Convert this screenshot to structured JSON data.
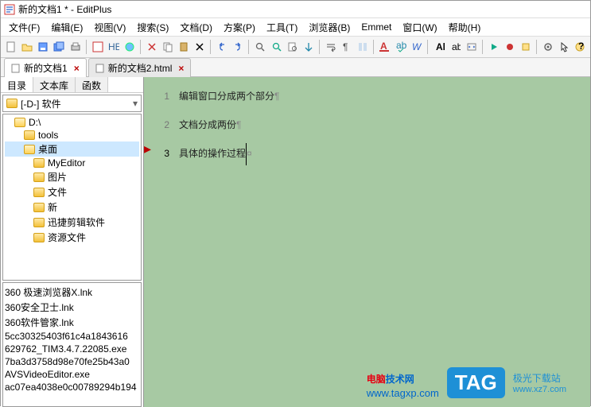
{
  "title": "新的文档1 * - EditPlus",
  "menu": [
    "文件(F)",
    "编辑(E)",
    "视图(V)",
    "搜索(S)",
    "文档(D)",
    "方案(P)",
    "工具(T)",
    "浏览器(B)",
    "Emmet",
    "窗口(W)",
    "帮助(H)"
  ],
  "tabs": [
    {
      "label": "新的文档1",
      "active": true
    },
    {
      "label": "新的文档2.html",
      "active": false
    }
  ],
  "side": {
    "tabs": [
      "目录",
      "文本库",
      "函数"
    ],
    "drive": "[-D-] 软件",
    "tree": [
      {
        "label": "D:\\",
        "cls": "indent1",
        "open": true
      },
      {
        "label": "tools",
        "cls": "indent2",
        "open": false
      },
      {
        "label": "桌面",
        "cls": "indent2 sel",
        "open": true
      },
      {
        "label": "MyEditor",
        "cls": "indent3",
        "open": false
      },
      {
        "label": "图片",
        "cls": "indent3",
        "open": false
      },
      {
        "label": "文件",
        "cls": "indent3",
        "open": false
      },
      {
        "label": "新",
        "cls": "indent3",
        "open": false
      },
      {
        "label": "迅捷剪辑软件",
        "cls": "indent3",
        "open": false
      },
      {
        "label": "资源文件",
        "cls": "indent3",
        "open": false
      }
    ],
    "files": [
      "360 极速浏览器X.lnk",
      "360安全卫士.lnk",
      "360软件管家.lnk",
      "5cc30325403f61c4a1843616",
      "629762_TIM3.4.7.22085.exe",
      "7ba3d3758d98e70fe25b43a0",
      "AVSVideoEditor.exe",
      "ac07ea4038e0c00789294b194"
    ]
  },
  "editor": {
    "lines": [
      {
        "n": "1",
        "text": "编辑窗口分成两个部分",
        "mark": "¶"
      },
      {
        "n": "2",
        "text": "文档分成两份",
        "mark": "¶"
      },
      {
        "n": "3",
        "text": "具体的操作过程",
        "mark": "¤",
        "current": true
      }
    ]
  },
  "wm": {
    "site1a": "电脑",
    "site1b": "技术网",
    "url1": "www.tagxp.com",
    "tag": "TAG",
    "site2": "极光下载站",
    "url2": "www.xz7.com"
  }
}
